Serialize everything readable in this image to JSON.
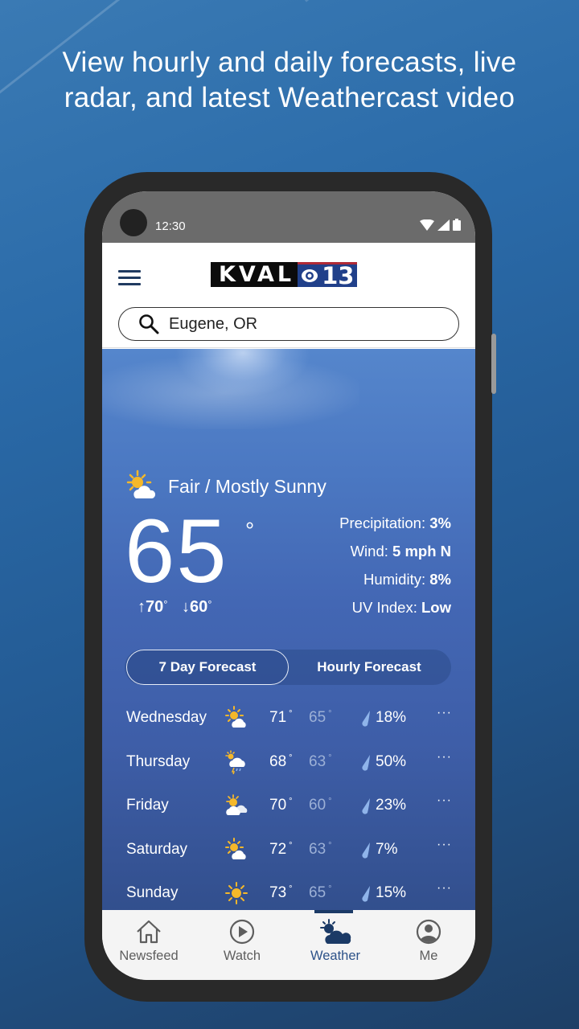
{
  "promo": {
    "line1": "View hourly and daily forecasts, live",
    "line2": "radar, and latest Weathercast video"
  },
  "status_bar": {
    "time": "12:30",
    "icons": [
      "wifi-icon",
      "signal-icon",
      "battery-icon"
    ]
  },
  "header": {
    "menu_icon": "hamburger-menu-icon",
    "logo": {
      "text": "KVAL",
      "channel": "13",
      "network_icon": "cbs-eye-icon"
    },
    "search": {
      "icon": "search-icon",
      "value": "Eugene, OR"
    }
  },
  "current": {
    "condition": "Fair / Mostly Sunny",
    "condition_icon": "partly-sunny-icon",
    "temp": "65",
    "degree": "°",
    "high": "↑70",
    "low": "↓60",
    "deg_mark": "°",
    "details": [
      {
        "label": "Precipitation: ",
        "value": "3%"
      },
      {
        "label": "Wind: ",
        "value": "5 mph N"
      },
      {
        "label": "Humidity: ",
        "value": "8%"
      },
      {
        "label": "UV Index: ",
        "value": "Low"
      }
    ]
  },
  "tabs": {
    "seven_day": "7 Day Forecast",
    "hourly": "Hourly Forecast",
    "active": "seven_day"
  },
  "forecast": [
    {
      "day": "Wednesday",
      "icon": "partly-sunny-icon",
      "high": "71",
      "low": "65",
      "precip": "18%"
    },
    {
      "day": "Thursday",
      "icon": "thunderstorm-rain-icon",
      "high": "68",
      "low": "63",
      "precip": "50%"
    },
    {
      "day": "Friday",
      "icon": "mostly-cloudy-icon",
      "high": "70",
      "low": "60",
      "precip": "23%"
    },
    {
      "day": "Saturday",
      "icon": "partly-sunny-icon",
      "high": "72",
      "low": "63",
      "precip": "7%"
    },
    {
      "day": "Sunday",
      "icon": "sunny-icon",
      "high": "73",
      "low": "65",
      "precip": "15%"
    }
  ],
  "forecast_deg": "°",
  "more_label": "···",
  "nav": [
    {
      "label": "Newsfeed",
      "icon": "home-icon"
    },
    {
      "label": "Watch",
      "icon": "play-icon"
    },
    {
      "label": "Weather",
      "icon": "weather-icon",
      "active": true
    },
    {
      "label": "Me",
      "icon": "profile-icon"
    }
  ],
  "colors": {
    "accent": "#2d5289",
    "nav_active": "#1b3a66",
    "sun": "#f5b82a",
    "drop": "#8fb4ea"
  }
}
